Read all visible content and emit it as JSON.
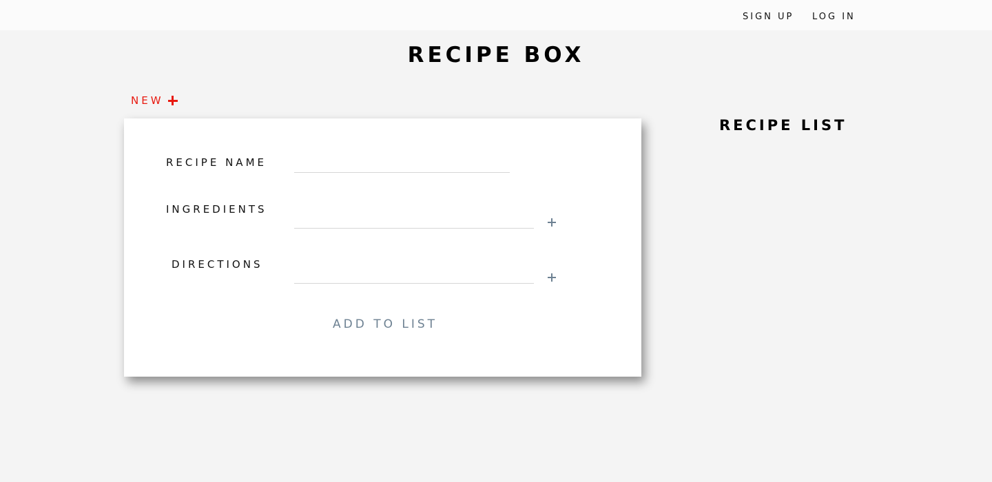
{
  "nav": {
    "sign_up": "SIGN UP",
    "log_in": "LOG IN"
  },
  "page": {
    "title": "RECIPE BOX"
  },
  "new_toggle": {
    "label": "NEW",
    "icon": "plus-icon",
    "color": "#e8190f"
  },
  "form": {
    "recipe_name_label": "RECIPE NAME",
    "recipe_name_value": "",
    "ingredients_label": "INGREDIENTS",
    "ingredients_value": "",
    "directions_label": "DIRECTIONS",
    "directions_value": "",
    "add_icon": "plus-icon",
    "submit_label": "ADD TO LIST",
    "accent_color": "#6d8192"
  },
  "recipe_list": {
    "title": "RECIPE LIST",
    "items": []
  }
}
